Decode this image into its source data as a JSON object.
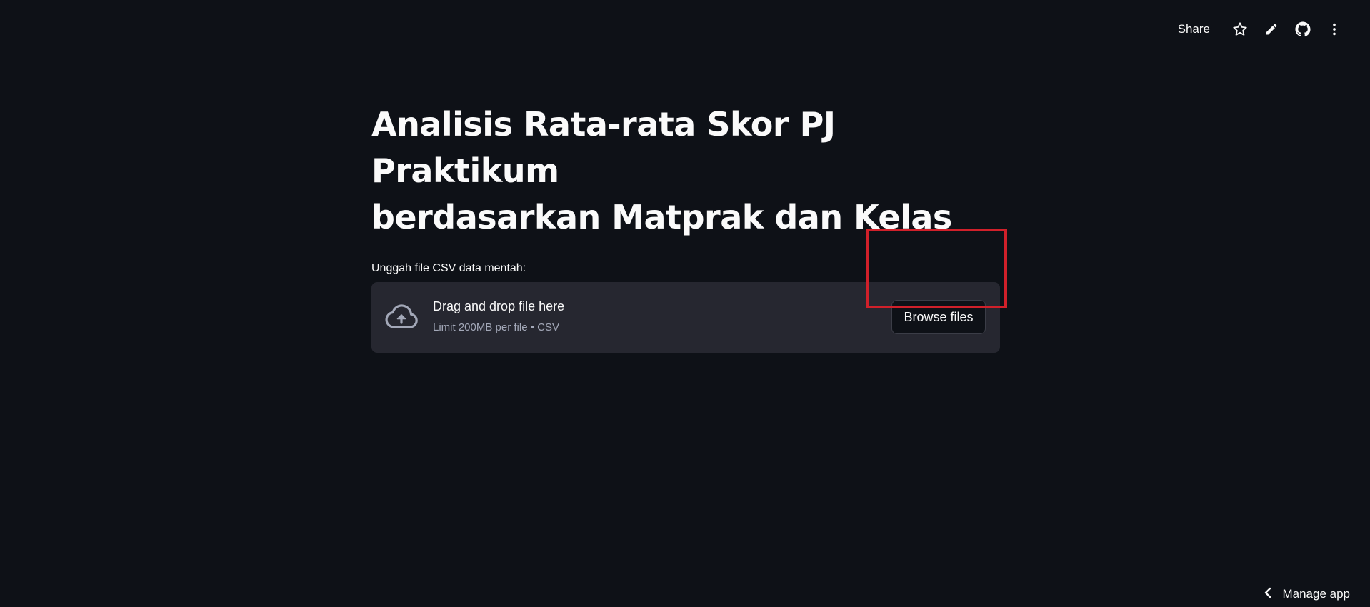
{
  "toolbar": {
    "share_label": "Share",
    "icons": [
      "star-icon",
      "pencil-icon",
      "github-icon",
      "more-vertical-icon"
    ]
  },
  "main": {
    "title_line1": "Analisis Rata-rata Skor PJ Praktikum",
    "title_line2": "berdasarkan Matprak dan Kelas",
    "uploader": {
      "label": "Unggah file CSV data mentah:",
      "instructions": "Drag and drop file here",
      "limit": "Limit 200MB per file • CSV",
      "browse_label": "Browse files",
      "icon": "cloud-upload-icon"
    }
  },
  "footer": {
    "manage_label": "Manage app",
    "icon": "chevron-left-icon"
  },
  "colors": {
    "background": "#0e1117",
    "dropzone": "#262730",
    "text": "#fafafa",
    "muted": "#a3a8b8",
    "highlight": "#d0202a"
  }
}
